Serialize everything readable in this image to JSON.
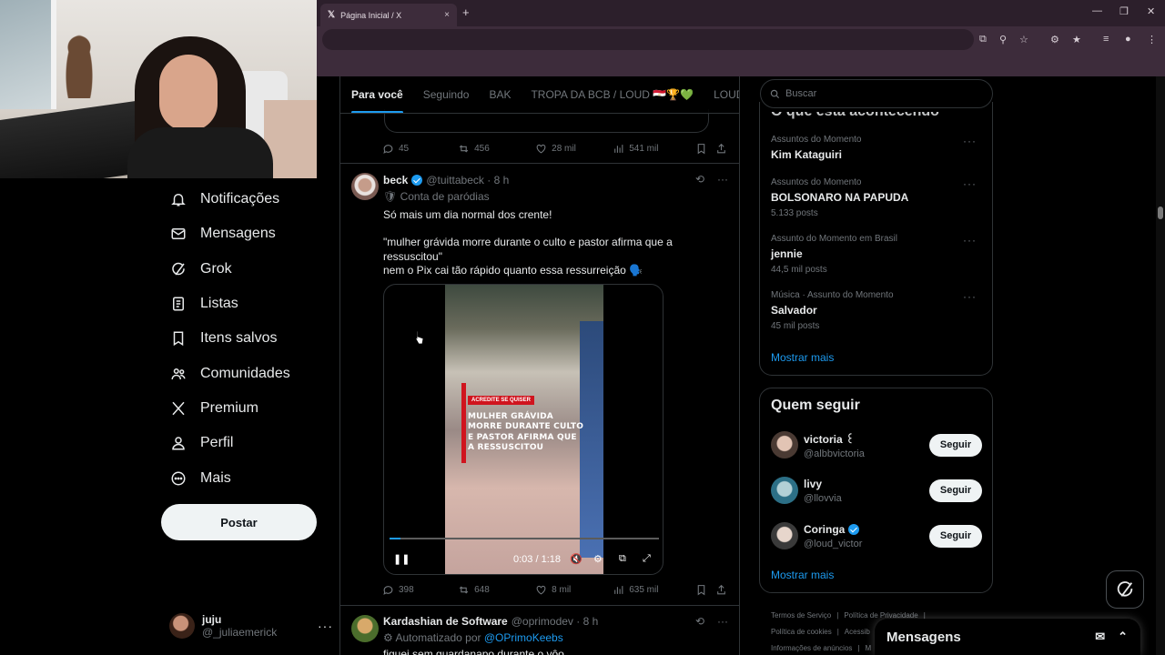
{
  "browser": {
    "tab_title": "Página Inicial / X",
    "tab_close": "×",
    "new_tab": "+"
  },
  "sidebar": {
    "items": [
      {
        "label": "Notificações",
        "icon": "bell-icon"
      },
      {
        "label": "Mensagens",
        "icon": "envelope-icon"
      },
      {
        "label": "Grok",
        "icon": "grok-icon"
      },
      {
        "label": "Listas",
        "icon": "list-icon"
      },
      {
        "label": "Itens salvos",
        "icon": "bookmark-icon"
      },
      {
        "label": "Comunidades",
        "icon": "people-icon"
      },
      {
        "label": "Premium",
        "icon": "x-logo-icon"
      },
      {
        "label": "Perfil",
        "icon": "person-icon"
      },
      {
        "label": "Mais",
        "icon": "more-circle-icon"
      }
    ],
    "post_button": "Postar",
    "account": {
      "name": "juju",
      "handle": "@_juliaemerick"
    }
  },
  "main": {
    "tabs": [
      "Para você",
      "Seguindo",
      "BAK",
      "TROPA DA BCB / LOUD 🇪🇬🏆💚",
      "LOUD Co"
    ],
    "prev_tweet_actions": {
      "replies": "45",
      "reposts": "456",
      "likes": "28 mil",
      "views": "541 mil"
    },
    "tweets": [
      {
        "name": "beck",
        "handle": "@tuittabeck · 8 h",
        "sub_label": "Conta de paródias",
        "lines": [
          "Só mais um dia normal dos crente!",
          "\"mulher grávida morre durante o culto e pastor afirma que a ressuscitou\"",
          "nem o Pix cai tão rápido quanto essa ressurreição 🗣️"
        ],
        "video": {
          "badge": "ACREDITE SE QUISER",
          "overlay": "MULHER GRÁVIDA MORRE DURANTE CULTO E PASTOR AFIRMA QUE A RESSUSCITOU",
          "time": "0:03 / 1:18",
          "progress": 0.04
        },
        "actions": {
          "replies": "398",
          "reposts": "648",
          "likes": "8 mil",
          "views": "635 mil"
        }
      },
      {
        "name": "Kardashian de Software",
        "handle": "@oprimodev · 8 h",
        "sub_label_prefix": "Automatizado por",
        "sub_label_link": "@OPrimoKeebs",
        "lines": [
          "fiquei sem guardanapo durante o vôo"
        ]
      }
    ]
  },
  "right": {
    "search_placeholder": "Buscar",
    "trends_header": "O que está acontecendo",
    "trends": [
      {
        "context": "Assuntos do Momento",
        "title": "Kim Kataguiri",
        "count": ""
      },
      {
        "context": "Assuntos do Momento",
        "title": "BOLSONARO NA PAPUDA",
        "count": "5.133 posts"
      },
      {
        "context": "Assunto do Momento em Brasil",
        "title": "jennie",
        "count": "44,5 mil posts"
      },
      {
        "context": "Música · Assunto do Momento",
        "title": "Salvador",
        "count": "45 mil posts"
      }
    ],
    "show_more": "Mostrar mais",
    "who_to_follow": {
      "title": "Quem seguir",
      "users": [
        {
          "name": "victoria ꒰",
          "handle": "@albbvictoria",
          "verified": false
        },
        {
          "name": "livy",
          "handle": "@llovvia",
          "verified": false
        },
        {
          "name": "Coringa",
          "handle": "@loud_victor",
          "verified": true
        }
      ],
      "follow_label": "Seguir",
      "show_more": "Mostrar mais"
    },
    "footer": [
      "Termos de Serviço",
      "|",
      "Política de Privacidade",
      "|",
      "Política de cookies",
      "|",
      "Acessib",
      "Informações de anúncios",
      "|",
      "M"
    ],
    "messages_drawer": "Mensagens"
  },
  "colors": {
    "accent": "#1d9bf0",
    "background": "#000000",
    "browser_chrome": "#3d2c3b"
  }
}
